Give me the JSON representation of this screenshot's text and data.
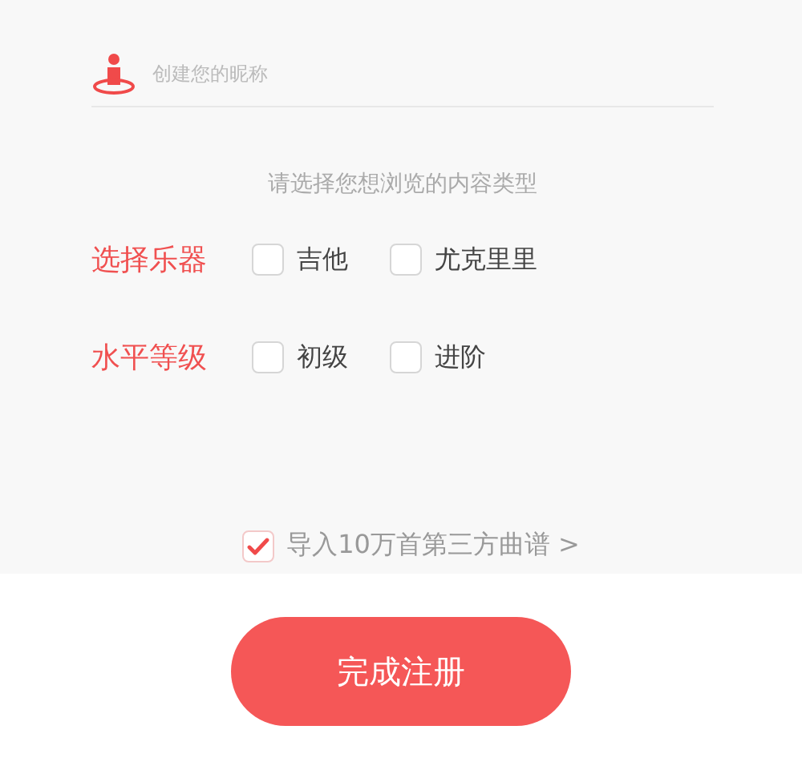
{
  "nickname_field": {
    "placeholder": "创建您的昵称"
  },
  "prompt": "请选择您想浏览的内容类型",
  "groups": [
    {
      "label": "选择乐器",
      "options": [
        {
          "label": "吉他",
          "checked": false
        },
        {
          "label": "尤克里里",
          "checked": false
        }
      ]
    },
    {
      "label": "水平等级",
      "options": [
        {
          "label": "初级",
          "checked": false
        },
        {
          "label": "进阶",
          "checked": false
        }
      ]
    }
  ],
  "import_option": {
    "label": "导入10万首第三方曲谱 >",
    "checked": true
  },
  "submit_button": "完成注册"
}
